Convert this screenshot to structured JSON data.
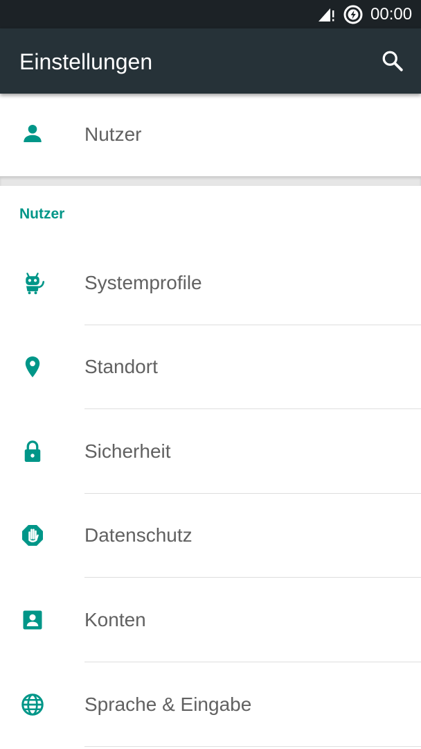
{
  "status_bar": {
    "time": "00:00",
    "icons": [
      "signal-alert-icon",
      "sync-icon"
    ]
  },
  "app_bar": {
    "title": "Einstellungen",
    "search_icon": "search-icon"
  },
  "user_card": {
    "label": "Nutzer",
    "icon": "person-icon"
  },
  "section": {
    "header": "Nutzer",
    "items": [
      {
        "label": "Systemprofile",
        "icon": "robot-icon"
      },
      {
        "label": "Standort",
        "icon": "location-pin-icon"
      },
      {
        "label": "Sicherheit",
        "icon": "lock-icon"
      },
      {
        "label": "Datenschutz",
        "icon": "privacy-hand-icon"
      },
      {
        "label": "Konten",
        "icon": "account-box-icon"
      },
      {
        "label": "Sprache & Eingabe",
        "icon": "globe-icon"
      }
    ]
  },
  "colors": {
    "accent": "#009688",
    "app_bar": "#263238",
    "status_bar": "#1c2226",
    "text": "#616161"
  }
}
